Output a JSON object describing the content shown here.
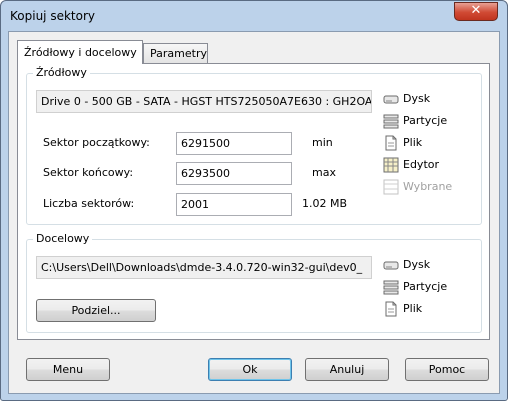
{
  "window": {
    "title": "Kopiuj sektory",
    "close_label": "✕"
  },
  "tabs": [
    {
      "label": "Źródłowy i docelowy"
    },
    {
      "label": "Parametry"
    }
  ],
  "source": {
    "group_label": "Źródłowy",
    "drive": "Drive 0 - 500 GB - SATA - HGST HTS725050A7E630 : GH2OA",
    "start_label": "Sektor początkowy:",
    "start_value": "6291500",
    "start_unit": "min",
    "end_label": "Sektor końcowy:",
    "end_value": "6293500",
    "end_unit": "max",
    "count_label": "Liczba sektorów:",
    "count_value": "2001",
    "count_size": "1.02 MB",
    "options": [
      {
        "label": "Dysk",
        "icon": "disk-icon"
      },
      {
        "label": "Partycje",
        "icon": "partitions-icon"
      },
      {
        "label": "Plik",
        "icon": "file-icon"
      },
      {
        "label": "Edytor",
        "icon": "editor-icon"
      },
      {
        "label": "Wybrane",
        "icon": "selected-icon"
      }
    ]
  },
  "destination": {
    "group_label": "Docelowy",
    "path": "C:\\Users\\Dell\\Downloads\\dmde-3.4.0.720-win32-gui\\dev0_",
    "split_button": "Podziel...",
    "options": [
      {
        "label": "Dysk",
        "icon": "disk-icon"
      },
      {
        "label": "Partycje",
        "icon": "partitions-icon"
      },
      {
        "label": "Plik",
        "icon": "file-icon"
      }
    ]
  },
  "footer": {
    "menu": "Menu",
    "ok": "Ok",
    "cancel": "Anuluj",
    "help": "Pomoc"
  }
}
